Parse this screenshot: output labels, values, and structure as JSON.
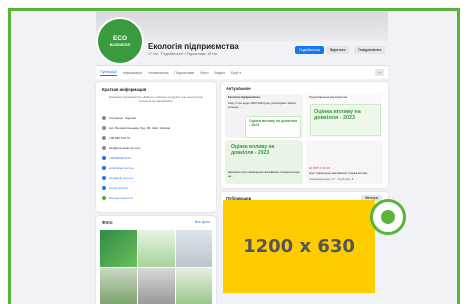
{
  "profile": {
    "logo_line1": "ECO",
    "logo_line2": "BUSINESS",
    "title": "Екологія підприємства",
    "subtitle": "17 тис. \"Подобається\" • Підписники: 18 тис.",
    "buttons": [
      "Подобається",
      "Відмітити",
      "Повідомлення"
    ]
  },
  "tabs": [
    "Публікації",
    "Інформація",
    "Упоминания",
    "Подписчики",
    "Фото",
    "Видео",
    "Ещё ▾"
  ],
  "tab_more": "···",
  "intro": {
    "title": "Краткая информация",
    "text": "Зовнішнє підприємство «Ефект» створює продукти для екологічних спеціалістів підприємств",
    "rows": [
      {
        "text": "Страница · Журнал",
        "link": false
      },
      {
        "text": "вул. Велика Кільцева, буд. 4Б, Київ, Україна",
        "link": false
      },
      {
        "text": "+38 050 270 72",
        "link": false
      },
      {
        "text": "eko@e-ecoinfo.com.ua",
        "link": false
      },
      {
        "text": "+380500307474",
        "link": true
      },
      {
        "text": "ecolinkcap.com.ua",
        "link": true
      },
      {
        "text": "ecodigrob.com.ua",
        "link": true
      },
      {
        "text": "ecovg.com.ua",
        "link": true
      },
      {
        "text": "Всегда открыто ▾",
        "link": true
      }
    ]
  },
  "photos": {
    "title": "Фото",
    "link": "Все фото"
  },
  "featured": {
    "title": "Актуальное",
    "item1_title": "Екологія підприємства",
    "item1_text": "Кому з про щодо 1503 2023 року розписувати багато кольору ...",
    "item2_title": "Представлення мероприятия",
    "eval_text": "Оцінка впливу на довкілля - 2023",
    "item3_caption": "Записано курс підвищення кваліфікації «Оцінка впливу на...",
    "item4_date": "16 ЛЮТ О 16:00",
    "item4_caption": "Курс підвищення кваліфікації: Оцінка впливу...",
    "item4_meta": "Новорожденные: 17 · Подборка: 8"
  },
  "posts": {
    "title": "Публикации",
    "filter": "Фильтры"
  },
  "placeholder_label": "1200 x 630",
  "colors": {
    "frame_green": "#5ab33a",
    "placeholder_yellow": "#ffcc00",
    "facebook_blue": "#1877f2"
  }
}
